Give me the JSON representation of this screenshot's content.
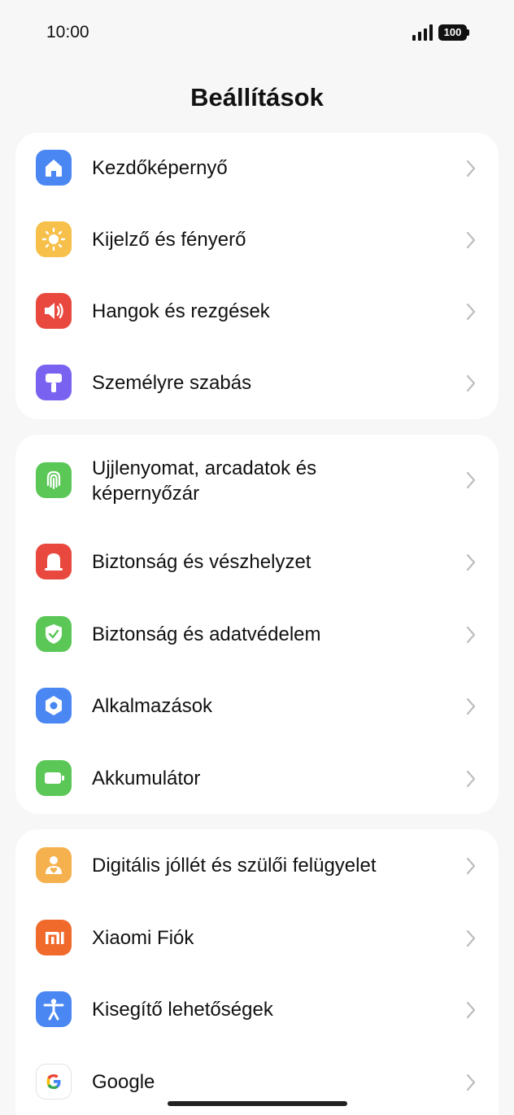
{
  "status": {
    "time": "10:00",
    "battery": "100"
  },
  "header": {
    "title": "Beállítások"
  },
  "groups": [
    {
      "items": [
        {
          "label": "Kezdőképernyő",
          "icon": "home-icon",
          "color": "#4a87f3"
        },
        {
          "label": "Kijelző és fényerő",
          "icon": "sun-icon",
          "color": "#f6c04a"
        },
        {
          "label": "Hangok és rezgések",
          "icon": "speaker-icon",
          "color": "#e9483e"
        },
        {
          "label": "Személyre szabás",
          "icon": "brush-icon",
          "color": "#7a62f0"
        }
      ]
    },
    {
      "items": [
        {
          "label": "Ujjlenyomat, arcadatok és",
          "label2": "képernyőzár",
          "icon": "fingerprint-icon",
          "color": "#5bc757"
        },
        {
          "label": "Biztonság és vészhelyzet",
          "icon": "emergency-light-icon",
          "color": "#e9483e"
        },
        {
          "label": "Biztonság és adatvédelem",
          "icon": "shield-check-icon",
          "color": "#5bc757"
        },
        {
          "label": "Alkalmazások",
          "icon": "apps-gear-icon",
          "color": "#4a87f3"
        },
        {
          "label": "Akkumulátor",
          "icon": "battery-icon",
          "color": "#5bc757"
        }
      ]
    },
    {
      "items": [
        {
          "label": "Digitális jóllét és szülői felügyelet",
          "icon": "wellbeing-icon",
          "color": "#f5b14e"
        },
        {
          "label": "Xiaomi Fiók",
          "icon": "mi-logo-icon",
          "color": "#f06a2c"
        },
        {
          "label": "Kisegítő lehetőségek",
          "icon": "accessibility-icon",
          "color": "#4a87f3"
        },
        {
          "label": "Google",
          "icon": "google-logo-icon",
          "color": "#ffffff"
        }
      ]
    }
  ]
}
